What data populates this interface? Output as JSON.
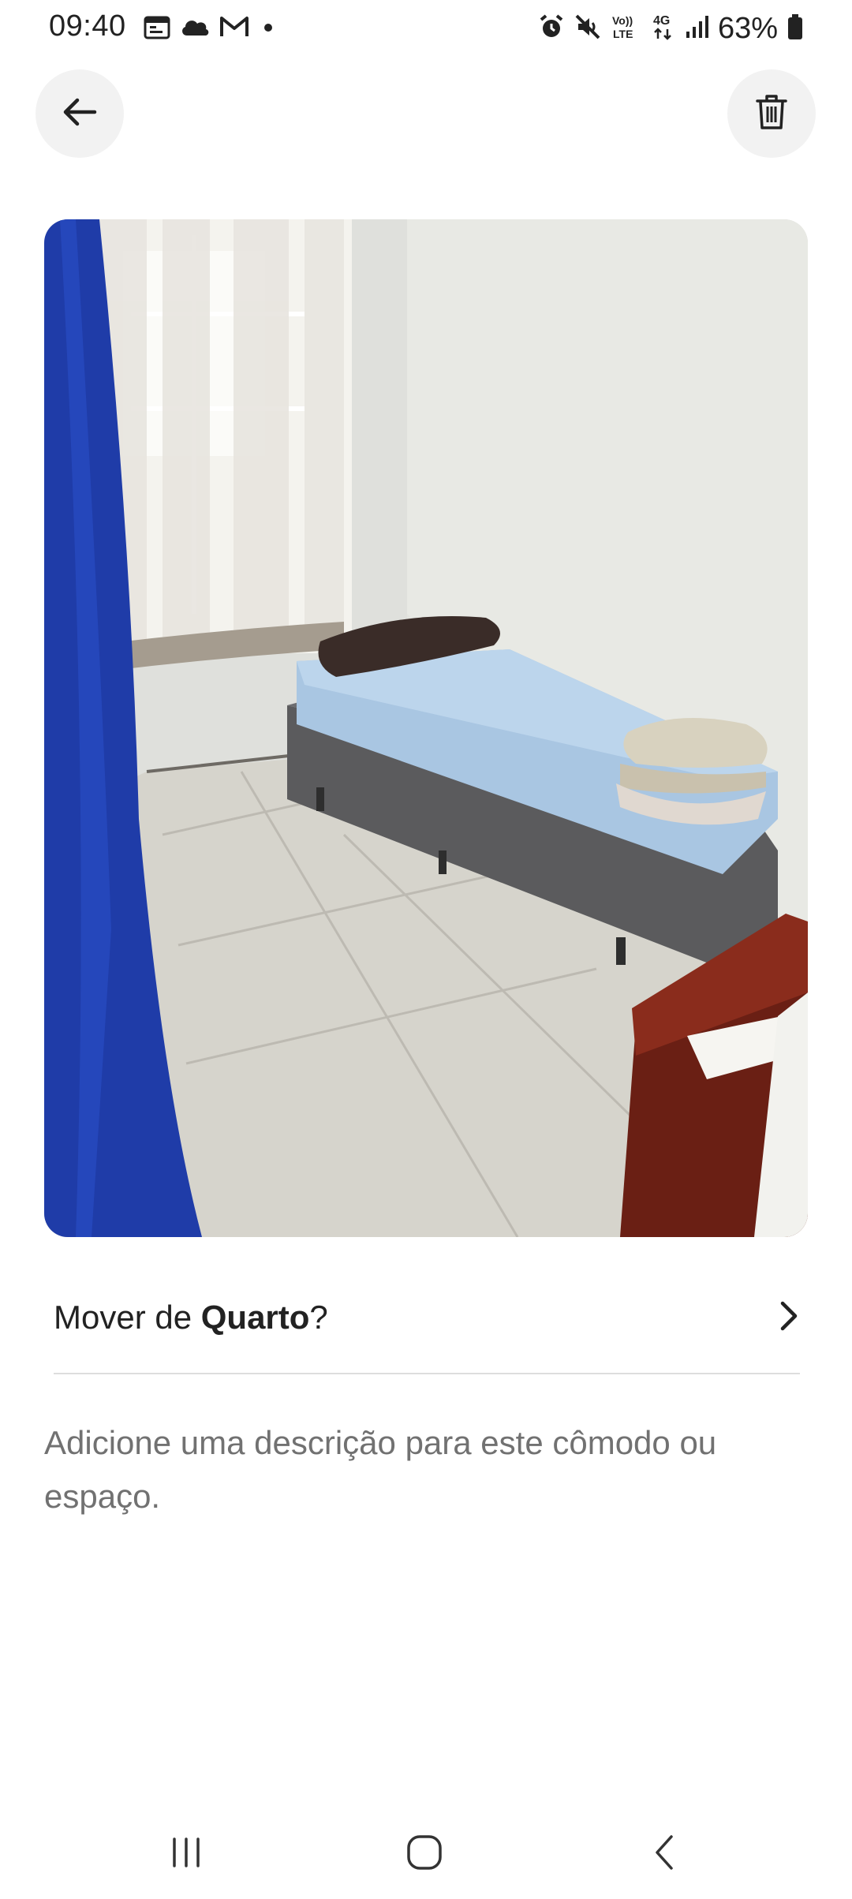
{
  "status_bar": {
    "time": "09:40",
    "battery": "63%",
    "left_icons": [
      "calendar-icon",
      "cloud-icon",
      "gmail-icon",
      "notification-dot-icon"
    ],
    "right_icons": [
      "alarm-icon",
      "mute-icon",
      "volte-icon",
      "4g-data-icon",
      "signal-icon",
      "battery-icon"
    ],
    "volte_label": "Vo)) LTE",
    "network_label": "4G"
  },
  "header": {
    "back_icon": "arrow-left-icon",
    "delete_icon": "trash-icon"
  },
  "photo": {
    "subject": "bedroom-photo"
  },
  "move_row": {
    "prefix": "Mover de ",
    "room": "Quarto",
    "suffix": "?",
    "icon": "chevron-right-icon"
  },
  "description": {
    "placeholder": "Adicione uma descrição para este cômodo ou espaço."
  },
  "nav_bar": {
    "icons": [
      "recents-icon",
      "home-icon",
      "back-icon"
    ]
  }
}
